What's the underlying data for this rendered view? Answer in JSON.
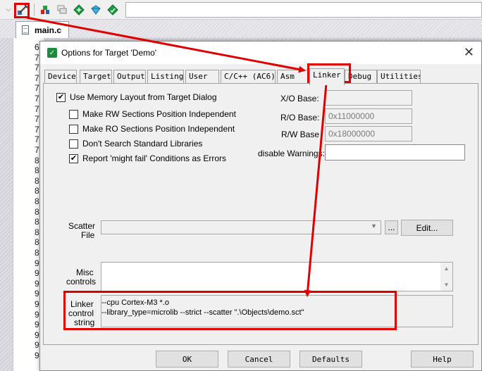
{
  "ide": {
    "toolbar": {
      "buttons": [
        {
          "name": "dropdown-chevron-icon",
          "glyph": "⌵"
        },
        {
          "name": "target-options-icon",
          "glyph": "🔧"
        },
        {
          "name": "manage-components-icon",
          "glyph": "▲"
        },
        {
          "name": "stack-icon",
          "glyph": "≡"
        },
        {
          "name": "diamond-green-icon",
          "glyph": "◆"
        },
        {
          "name": "pack-installer-icon",
          "glyph": "◈"
        },
        {
          "name": "select-packs-icon",
          "glyph": "◆"
        }
      ]
    },
    "file_tab": {
      "label": "main.c"
    },
    "gutter_lines": [
      "6",
      "7",
      "7",
      "7",
      "7",
      "7",
      "7",
      "7",
      "7",
      "7",
      "7",
      "8",
      "8",
      "8",
      "8",
      "8",
      "8",
      "8",
      "8",
      "8",
      "8",
      "9",
      "9",
      "9",
      "9",
      "9",
      "9",
      "9",
      "9",
      "9",
      "9"
    ]
  },
  "dialog": {
    "title": "Options for Target 'Demo'",
    "close_glyph": "✕",
    "tabs": [
      {
        "label": "Device"
      },
      {
        "label": "Target"
      },
      {
        "label": "Output"
      },
      {
        "label": "Listing"
      },
      {
        "label": "User"
      },
      {
        "label": "C/C++ (AC6)"
      },
      {
        "label": "Asm"
      },
      {
        "label": "Linker"
      },
      {
        "label": "Debug"
      },
      {
        "label": "Utilities"
      }
    ],
    "active_tab": "Linker",
    "linker": {
      "use_memory_layout": {
        "label": "Use Memory Layout from Target Dialog",
        "checked": true
      },
      "rw_position_independent": {
        "label": "Make RW Sections Position Independent",
        "checked": false
      },
      "ro_position_independent": {
        "label": "Make RO Sections Position Independent",
        "checked": false
      },
      "dont_search_std_libs": {
        "label": "Don't Search Standard Libraries",
        "checked": false
      },
      "report_might_fail": {
        "label": "Report 'might fail' Conditions as Errors",
        "checked": true
      },
      "xo_base": {
        "label": "X/O Base:",
        "value": ""
      },
      "ro_base": {
        "label": "R/O Base:",
        "value": "0x11000000"
      },
      "rw_base": {
        "label": "R/W Base",
        "value": "0x18000000"
      },
      "disable_warnings": {
        "label": "disable Warnings:",
        "value": ""
      },
      "scatter_file": {
        "label_line1": "Scatter",
        "label_line2": "File",
        "value": "",
        "browse_label": "...",
        "edit_label": "Edit..."
      },
      "misc_controls": {
        "label_line1": "Misc",
        "label_line2": "controls",
        "value": ""
      },
      "linker_control_string": {
        "label_line1": "Linker",
        "label_line2": "control",
        "label_line3": "string",
        "line1": "--cpu Cortex-M3 *.o",
        "line2": "--library_type=microlib --strict --scatter \".\\Objects\\demo.sct\""
      }
    },
    "buttons": {
      "ok": "OK",
      "cancel": "Cancel",
      "defaults": "Defaults",
      "help": "Help"
    }
  },
  "annotation_color": "#e00000"
}
